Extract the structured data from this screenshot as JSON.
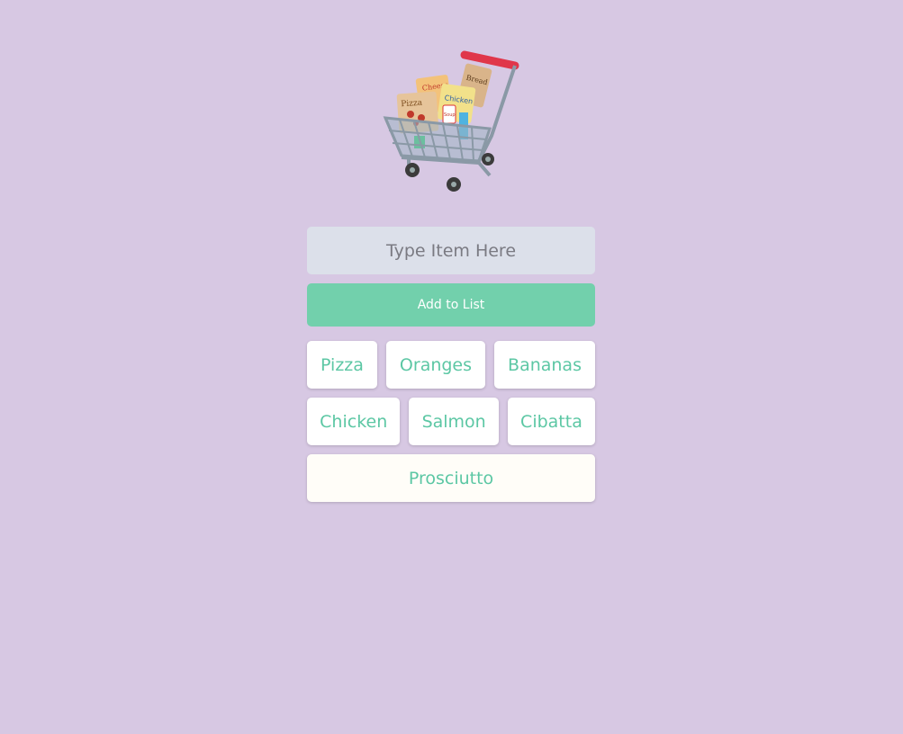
{
  "theme": {
    "background": "#d7c8e3",
    "accent": "#72d0ac",
    "chip_text": "#5cc7a4"
  },
  "logo": {
    "icon": "shopping-cart-icon",
    "labels": [
      "Cheese",
      "Bread",
      "Chicken",
      "Pizza",
      "Soup"
    ]
  },
  "input": {
    "placeholder": "Type Item Here",
    "value": ""
  },
  "add_button": {
    "label": "Add to List"
  },
  "list": {
    "items": [
      "Pizza",
      "Oranges",
      "Bananas",
      "Chicken",
      "Salmon",
      "Cibatta",
      "Prosciutto"
    ]
  }
}
